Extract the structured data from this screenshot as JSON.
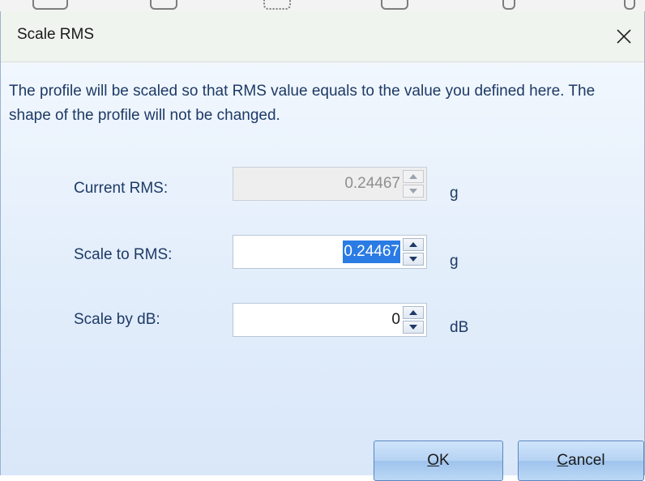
{
  "dialog": {
    "title": "Scale RMS",
    "description": "The profile will be scaled so that RMS value equals to the value you defined here. The shape of the profile will not be changed."
  },
  "fields": {
    "current_rms": {
      "label": "Current RMS:",
      "value": "0.24467",
      "unit": "g"
    },
    "scale_to_rms": {
      "label": "Scale to RMS:",
      "value": "0.24467",
      "unit": "g"
    },
    "scale_by_db": {
      "label": "Scale by dB:",
      "value": "0",
      "unit": "dB"
    }
  },
  "buttons": {
    "ok": {
      "mnemonic": "O",
      "rest": "K"
    },
    "cancel": {
      "mnemonic": "C",
      "rest": "ancel"
    }
  },
  "icons": {
    "close": "close-icon",
    "spin_up": "chevron-up-icon",
    "spin_down": "chevron-down-icon"
  },
  "colors": {
    "text_label": "#1e3a66",
    "selection": "#2a7be4",
    "button_border": "#5a87bf"
  }
}
